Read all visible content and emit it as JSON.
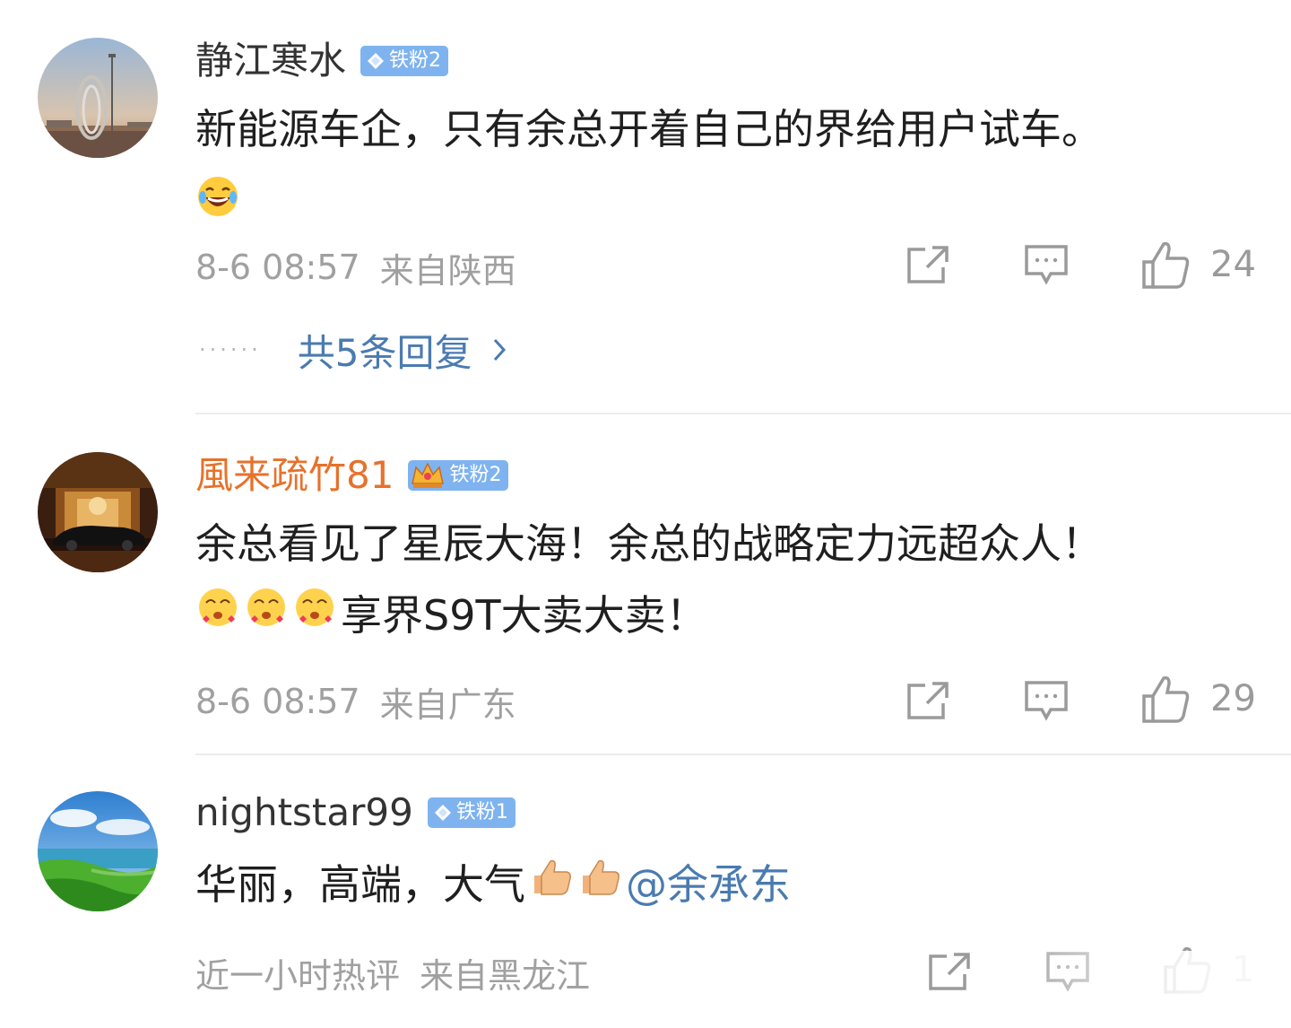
{
  "comments": [
    {
      "username": "静江寒水",
      "badge": "铁粉2",
      "badge_icon": "diamond-icon",
      "text_line1": "新能源车企，只有余总开着自己的界给用户试车。",
      "emoji_1": "laughing-tears-emoji",
      "time": "8-6 08:57",
      "location": "来自陕西",
      "likes": "24",
      "replies": "共5条回复"
    },
    {
      "username": "風来疏竹81",
      "badge": "铁粉2",
      "badge_icon": "crown-icon",
      "text_line1": "余总看见了星辰大海！余总的战略定力远超众人！",
      "text_line2": "享界S9T大卖大卖！",
      "emoji_1": "heart-eyes-emoji",
      "time": "8-6 08:57",
      "location": "来自广东",
      "likes": "29"
    },
    {
      "username": "nightstar99",
      "badge": "铁粉1",
      "badge_icon": "diamond-icon",
      "text_line1": "华丽，高端，大气",
      "emoji_1": "thumbs-up-emoji",
      "mention": "@余承东",
      "time": "近一小时热评",
      "location": "来自黑龙江",
      "likes": "1"
    }
  ],
  "icons": {
    "share": "share-icon",
    "comment": "comment-icon",
    "like": "thumbs-up-icon",
    "chevron": "chevron-right-icon"
  },
  "colors": {
    "link": "#4a7bb0",
    "username_gold": "#e6722c",
    "badge": "#7fb3ef",
    "meta": "#a0a0a0"
  }
}
